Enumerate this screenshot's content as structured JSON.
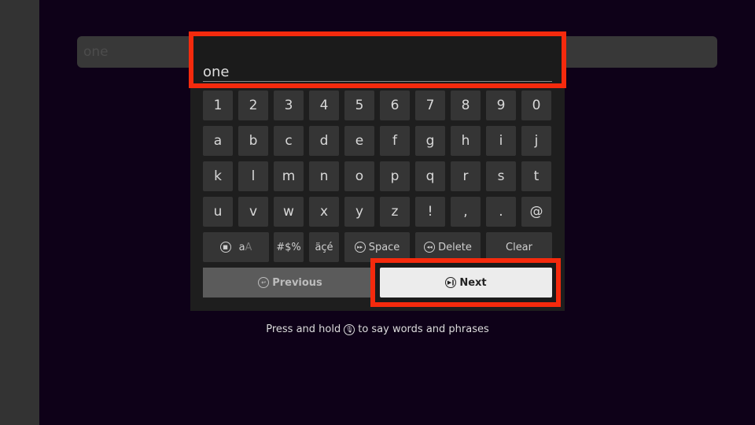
{
  "background_search": {
    "text": "one"
  },
  "input": {
    "value": "one"
  },
  "keyboard": {
    "rows": [
      [
        "1",
        "2",
        "3",
        "4",
        "5",
        "6",
        "7",
        "8",
        "9",
        "0"
      ],
      [
        "a",
        "b",
        "c",
        "d",
        "e",
        "f",
        "g",
        "h",
        "i",
        "j"
      ],
      [
        "k",
        "l",
        "m",
        "n",
        "o",
        "p",
        "q",
        "r",
        "s",
        "t"
      ],
      [
        "u",
        "v",
        "w",
        "x",
        "y",
        "z",
        "!",
        ",",
        ".",
        "@"
      ]
    ],
    "function_keys": {
      "case_small": "a",
      "case_big": "A",
      "symbols": "#$%",
      "accents": "äçé",
      "space": "Space",
      "delete": "Delete",
      "clear": "Clear"
    }
  },
  "nav": {
    "previous": "Previous",
    "next": "Next"
  },
  "hint": {
    "before": "Press and hold",
    "after": "to say words and phrases"
  },
  "colors": {
    "highlight": "#f52a0d",
    "background": "#0e0118"
  }
}
